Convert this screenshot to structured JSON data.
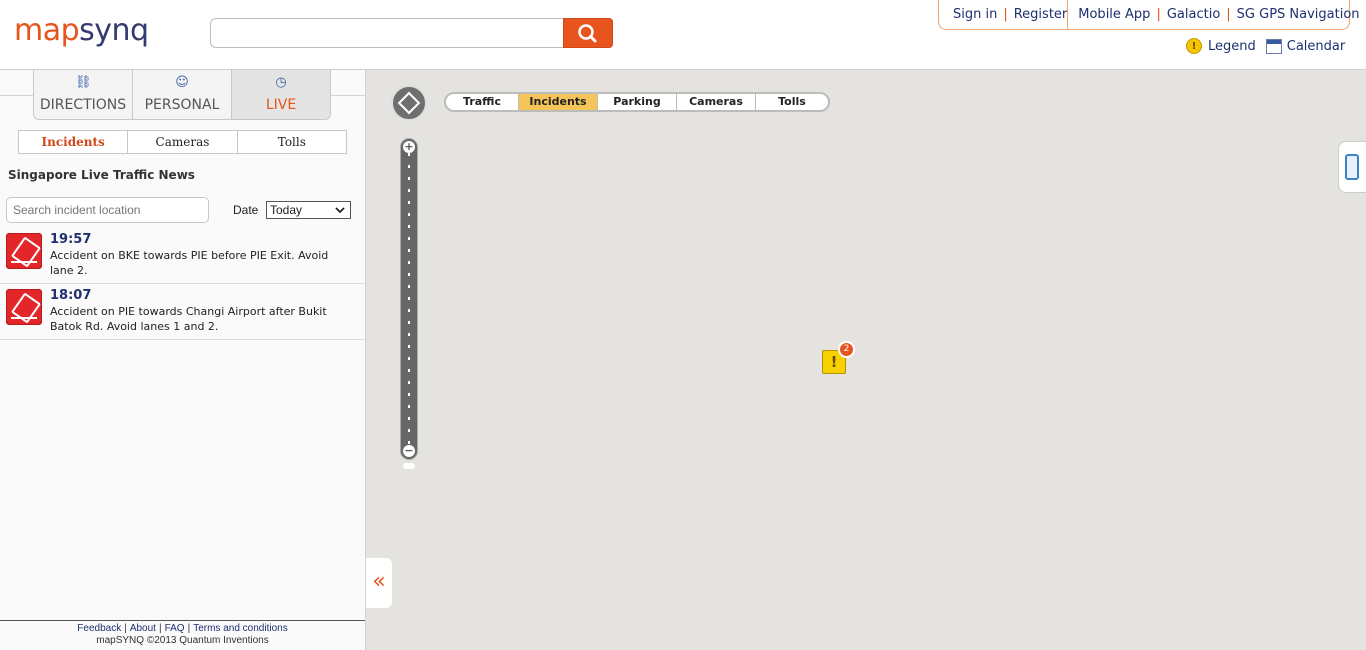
{
  "header": {
    "logo_a": "map",
    "logo_b": "synq",
    "search": {
      "placeholder": ""
    },
    "links": [
      "Sign in",
      "Register",
      "Mobile App",
      "Galactio",
      "SG GPS Navigation"
    ],
    "legend_label": "Legend",
    "calendar_label": "Calendar"
  },
  "sidebar": {
    "modes": [
      {
        "label": "DIRECTIONS",
        "icon": "car-icon"
      },
      {
        "label": "PERSONAL",
        "icon": "user-add-icon"
      },
      {
        "label": "LIVE",
        "icon": "clock-icon",
        "active": true
      }
    ],
    "subtabs": [
      "Incidents",
      "Cameras",
      "Tolls"
    ],
    "active_subtab": "Incidents",
    "panel_title": "Singapore Live Traffic News",
    "incident_search": {
      "value": "Search incident location"
    },
    "date": {
      "label": "Date",
      "selected": "Today"
    },
    "incidents": [
      {
        "time": "19:57",
        "text": "Accident on BKE towards PIE before PIE Exit. Avoid lane 2.",
        "icon": "accident-icon"
      },
      {
        "time": "18:07",
        "text": "Accident on PIE towards Changi Airport after Bukit Batok Rd. Avoid lanes 1 and 2.",
        "icon": "accident-icon"
      }
    ],
    "footer": {
      "links": [
        "Feedback",
        "About",
        "FAQ",
        "Terms and conditions"
      ],
      "copyright": "mapSYNQ ©2013 Quantum Inventions"
    }
  },
  "map": {
    "layer_tabs": [
      "Traffic",
      "Incidents",
      "Parking",
      "Cameras",
      "Tolls"
    ],
    "active_layer": "Incidents",
    "marker_count": "2",
    "marker_symbol": "!",
    "collapse_symbol": "«"
  },
  "colors": {
    "accent": "#e8541d",
    "navy": "#1f2f6f",
    "map_bg": "#e5e3df",
    "highlight": "#f5c55a"
  }
}
